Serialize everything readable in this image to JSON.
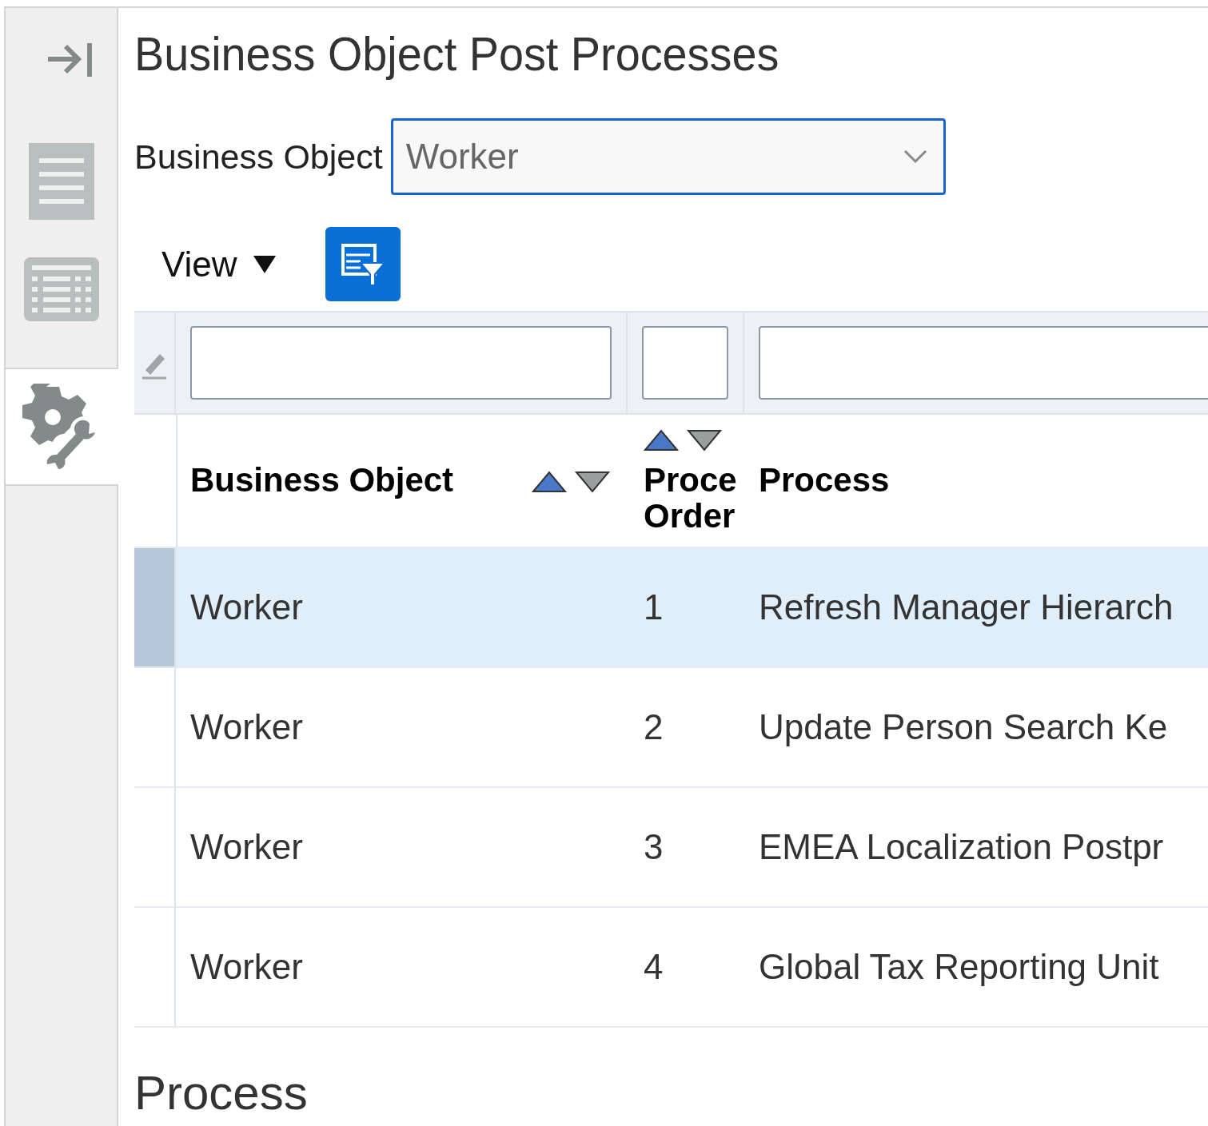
{
  "sidebar": {
    "items": [
      {
        "kind": "list",
        "selected": false
      },
      {
        "kind": "table",
        "selected": false
      },
      {
        "kind": "tools",
        "selected": true
      }
    ]
  },
  "title": "Business Object Post Processes",
  "business_object": {
    "label": "Business Object",
    "value": "Worker"
  },
  "toolbar": {
    "view_menu": "View"
  },
  "table": {
    "columns": [
      "Business Object",
      "Proce Order",
      "Process"
    ],
    "rows": [
      {
        "cells": [
          "Worker",
          "1",
          "Refresh Manager Hierarch"
        ],
        "selected": true
      },
      {
        "cells": [
          "Worker",
          "2",
          "Update Person Search Ke"
        ],
        "selected": false
      },
      {
        "cells": [
          "Worker",
          "3",
          "EMEA Localization Postpr"
        ],
        "selected": false
      },
      {
        "cells": [
          "Worker",
          "4",
          "Global Tax Reporting Unit"
        ],
        "selected": false
      }
    ]
  },
  "section_title": "Process"
}
